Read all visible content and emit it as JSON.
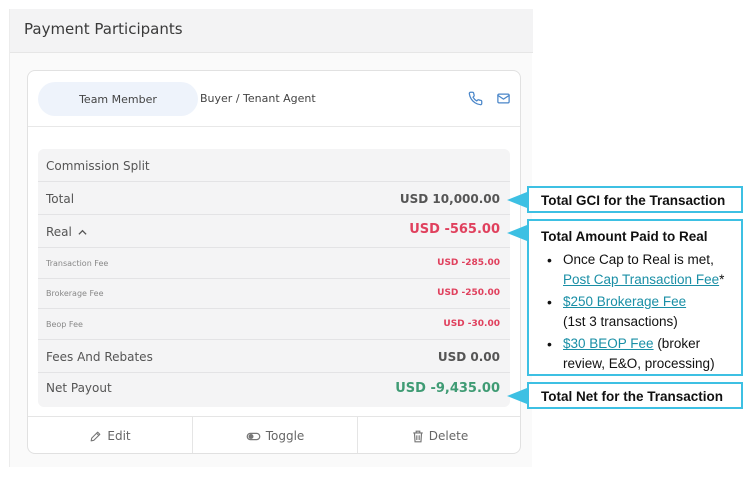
{
  "panel": {
    "title": "Payment Participants"
  },
  "member": {
    "badge": "Team Member",
    "role": "Buyer / Tenant Agent",
    "icons": [
      "phone-icon",
      "mail-icon"
    ]
  },
  "split": {
    "rows": [
      {
        "label": "Commission Split",
        "value": ""
      },
      {
        "label": "Total",
        "value": "USD 10,000.00"
      },
      {
        "label": "Real",
        "value": "USD -565.00"
      },
      {
        "label": "Transaction Fee",
        "value": "USD -285.00"
      },
      {
        "label": "Brokerage Fee",
        "value": "USD -250.00"
      },
      {
        "label": "Beop Fee",
        "value": "USD -30.00"
      },
      {
        "label": "Fees And Rebates",
        "value": "USD 0.00"
      },
      {
        "label": "Net Payout",
        "value": "USD -9,435.00"
      }
    ]
  },
  "actions": {
    "edit": "Edit",
    "toggle": "Toggle",
    "delete": "Delete"
  },
  "callouts": {
    "gci": "Total GCI for the Transaction",
    "real": {
      "title": "Total Amount Paid to Real",
      "item1_text": "Once Cap to Real is met,",
      "item1_link": "Post Cap Transaction Fee",
      "item1_suffix": "*",
      "item2_link": "$250 Brokerage Fee",
      "item2_text": "(1st 3 transactions)",
      "item3_link": "$30 BEOP Fee",
      "item3_text": " (broker review, E&O, processing)"
    },
    "net": "Total Net for the Transaction"
  },
  "colors": {
    "accent": "#3dc0e3",
    "negative": "#e0405d",
    "positive": "#3f9b74",
    "link": "#1a8fa6"
  }
}
